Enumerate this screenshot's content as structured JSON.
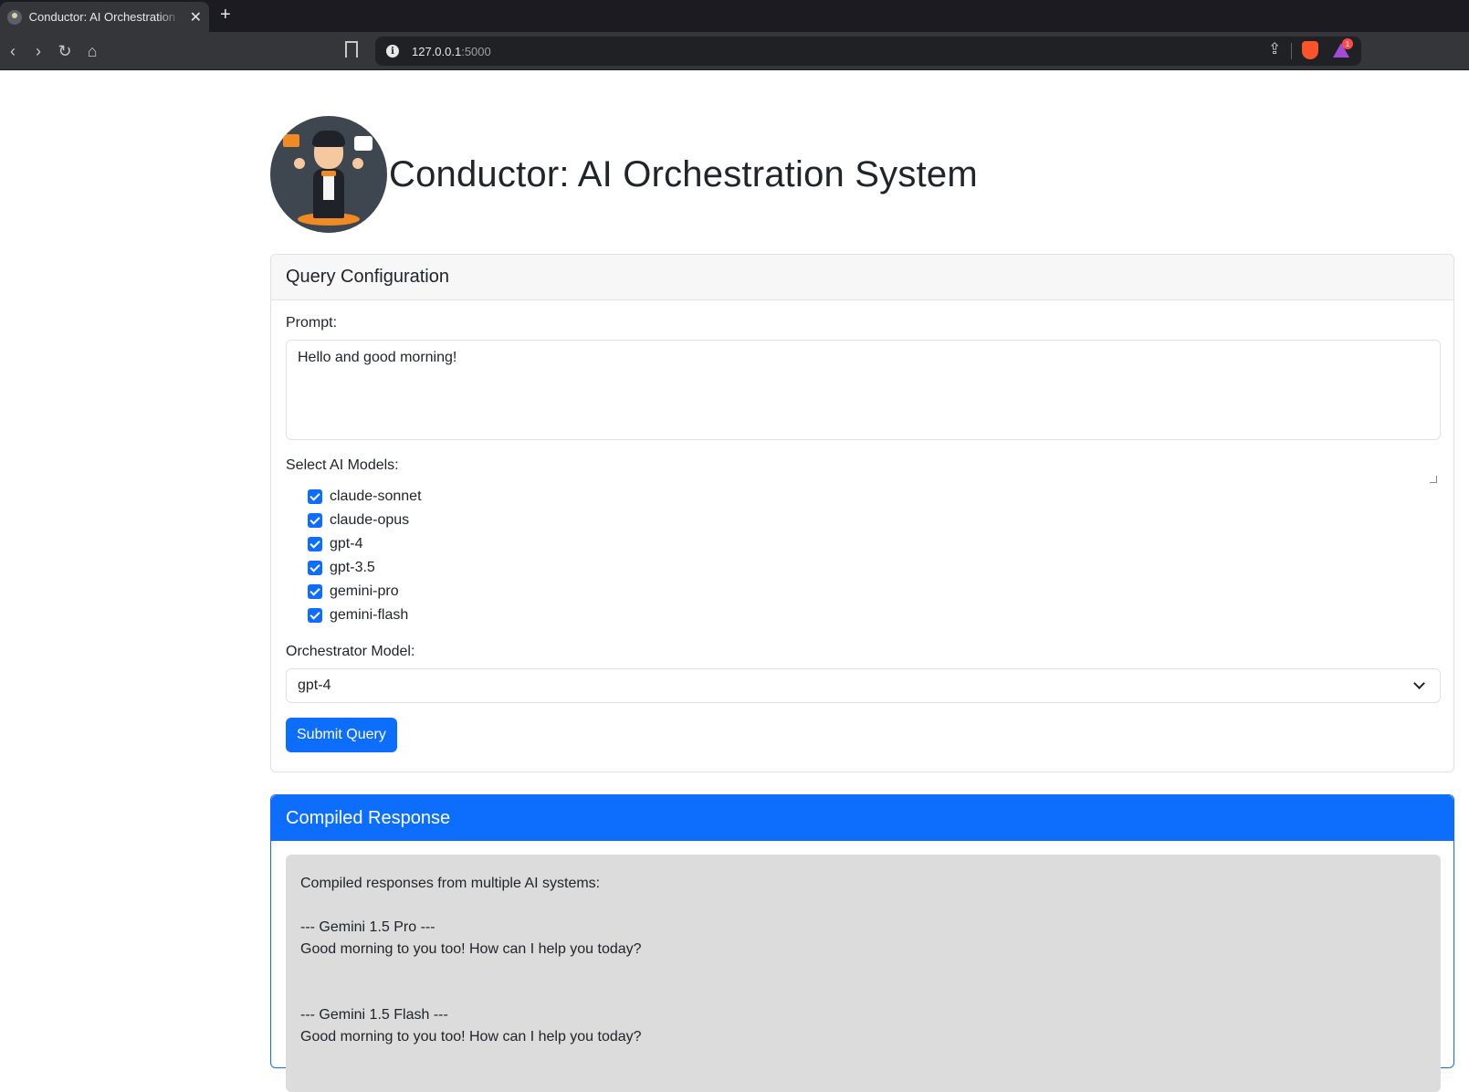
{
  "browser": {
    "tab_title": "Conductor: AI Orchestration System",
    "close_glyph": "✕",
    "newtab_glyph": "+",
    "url_host": "127.0.0.1",
    "url_port": ":5000",
    "rewards_badge": "1"
  },
  "header": {
    "title": "Conductor: AI Orchestration System"
  },
  "config": {
    "card_title": "Query Configuration",
    "prompt_label": "Prompt:",
    "prompt_value": "Hello and good morning!",
    "models_label": "Select AI Models:",
    "models": [
      {
        "label": "claude-sonnet",
        "checked": true
      },
      {
        "label": "claude-opus",
        "checked": true
      },
      {
        "label": "gpt-4",
        "checked": true
      },
      {
        "label": "gpt-3.5",
        "checked": true
      },
      {
        "label": "gemini-pro",
        "checked": true
      },
      {
        "label": "gemini-flash",
        "checked": true
      }
    ],
    "orchestrator_label": "Orchestrator Model:",
    "orchestrator_value": "gpt-4",
    "submit_label": "Submit Query"
  },
  "response": {
    "card_title": "Compiled Response",
    "text": "Compiled responses from multiple AI systems:\n\n--- Gemini 1.5 Pro ---\nGood morning to you too! How can I help you today?\n\n\n--- Gemini 1.5 Flash ---\nGood morning to you too! How can I help you today?"
  },
  "colors": {
    "primary": "#0d6efd",
    "response_bg": "#dcdcdc",
    "browser_dark": "#1c1b22"
  }
}
